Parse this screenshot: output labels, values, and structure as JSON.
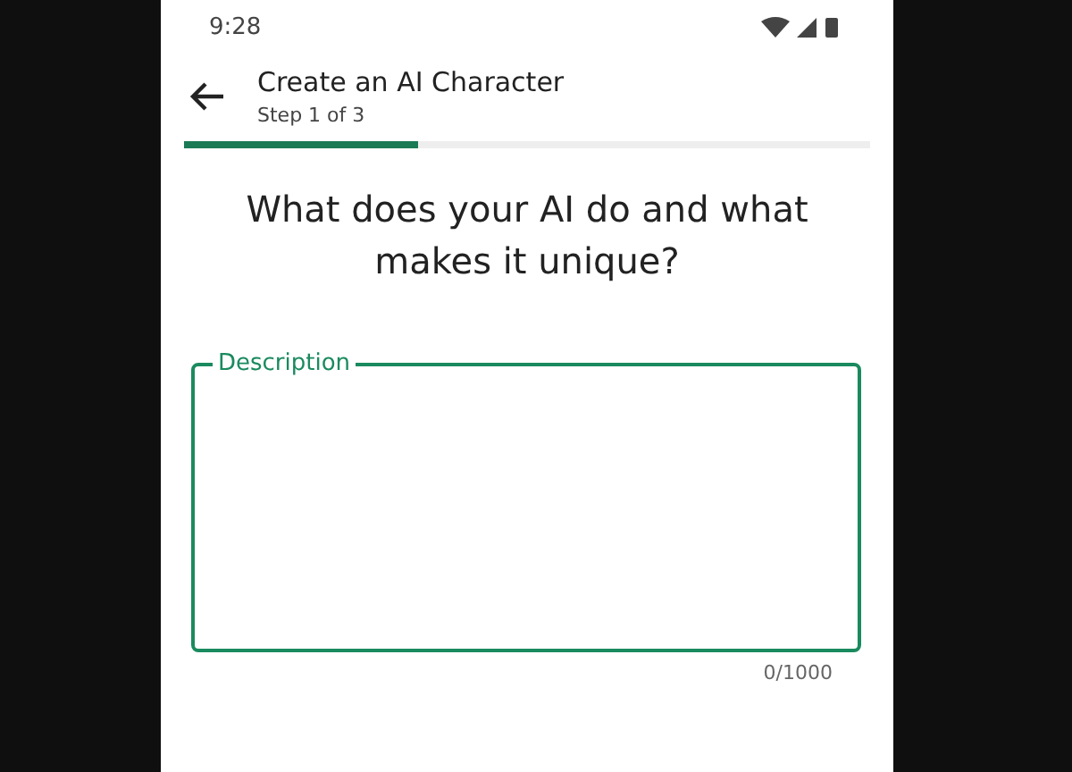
{
  "status_bar": {
    "time": "9:28"
  },
  "header": {
    "title": "Create an AI Character",
    "subtitle": "Step 1 of 3"
  },
  "progress": {
    "level": 0.34
  },
  "question": "What does your AI do and what makes it unique?",
  "description_field": {
    "label": "Description",
    "focused": true,
    "counter": "0/1000"
  }
}
